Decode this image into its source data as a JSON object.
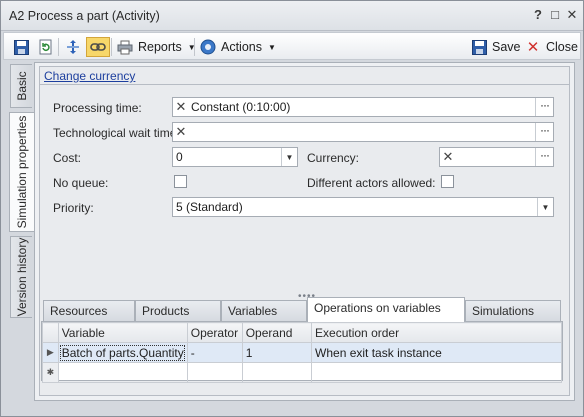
{
  "window": {
    "title": "A2 Process a part (Activity)",
    "help_label": "?",
    "maximize_label": "□",
    "close_label": "✕"
  },
  "toolbar": {
    "reports_label": "Reports",
    "actions_label": "Actions",
    "save_label": "Save",
    "close_label": "Close"
  },
  "vtabs": [
    {
      "label": "Basic"
    },
    {
      "label": "Simulation properties"
    },
    {
      "label": "Version history"
    }
  ],
  "form": {
    "change_currency_link": "Change currency",
    "processing_time_label": "Processing time:",
    "processing_time_value": "Constant (0:10:00)",
    "tech_wait_label": "Technological wait time:",
    "tech_wait_value": "",
    "cost_label": "Cost:",
    "cost_value": "0",
    "currency_label": "Currency:",
    "currency_value": "",
    "no_queue_label": "No queue:",
    "diff_actors_label": "Different actors allowed:",
    "priority_label": "Priority:",
    "priority_value": "5 (Standard)"
  },
  "bottom_tabs": [
    {
      "label": "Resources"
    },
    {
      "label": "Products"
    },
    {
      "label": "Variables"
    },
    {
      "label": "Operations on variables"
    },
    {
      "label": "Simulations"
    }
  ],
  "grid": {
    "columns": [
      "Variable",
      "Operator",
      "Operand",
      "Execution order"
    ],
    "rows": [
      {
        "variable": "Batch of parts.Quantity",
        "operator": "-",
        "operand": "1",
        "execution_order": "When exit task instance"
      }
    ],
    "new_row_marker": "✱",
    "current_row_marker": "▶"
  },
  "colors": {
    "link": "#1d3f9e",
    "selected_row": "#dfe9f6",
    "close_x": "#d0312d"
  }
}
